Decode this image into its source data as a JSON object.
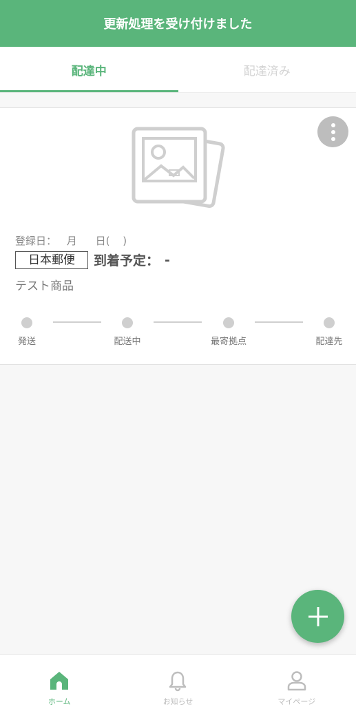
{
  "banner": {
    "message": "更新処理を受け付けました"
  },
  "tabs": [
    {
      "label": "配達中",
      "active": true
    },
    {
      "label": "配達済み",
      "active": false
    }
  ],
  "card": {
    "registered_label": "登録日：",
    "registered_month": "月",
    "registered_day": "日(",
    "registered_close": ")",
    "carrier": "日本郵便",
    "arrival_label": "到着予定：",
    "arrival_value": "-",
    "product_name": "テスト商品",
    "steps": [
      "発送",
      "配送中",
      "最寄拠点",
      "配達先"
    ]
  },
  "bottom_nav": {
    "home": "ホーム",
    "notifications": "お知らせ",
    "mypage": "マイページ"
  },
  "colors": {
    "accent": "#5ab57b",
    "inactive": "#bdbdbd"
  },
  "icons": {
    "photo": "image-placeholder-icon",
    "menu": "more-vertical-icon",
    "add": "plus-icon",
    "home": "home-icon",
    "notifications": "bell-icon",
    "mypage": "user-icon"
  }
}
